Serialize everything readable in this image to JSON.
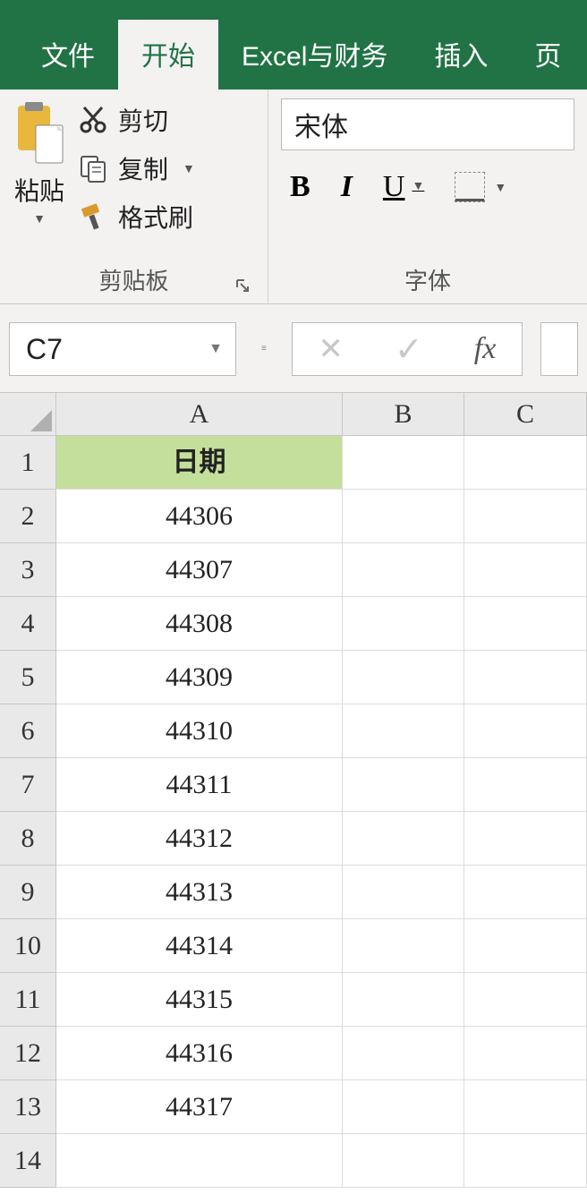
{
  "tabs": {
    "file": "文件",
    "home": "开始",
    "excel_finance": "Excel与财务",
    "insert": "插入",
    "page": "页"
  },
  "ribbon": {
    "clipboard": {
      "paste": "粘贴",
      "cut": "剪切",
      "copy": "复制",
      "format_painter": "格式刷",
      "group_label": "剪贴板"
    },
    "font": {
      "font_name": "宋体",
      "bold": "B",
      "italic": "I",
      "underline": "U",
      "group_label": "字体"
    }
  },
  "name_box": "C7",
  "columns": [
    "A",
    "B",
    "C"
  ],
  "rows": [
    "1",
    "2",
    "3",
    "4",
    "5",
    "6",
    "7",
    "8",
    "9",
    "10",
    "11",
    "12",
    "13",
    "14"
  ],
  "data": {
    "a_header": "日期",
    "a_values": [
      "44306",
      "44307",
      "44308",
      "44309",
      "44310",
      "44311",
      "44312",
      "44313",
      "44314",
      "44315",
      "44316",
      "44317"
    ]
  }
}
